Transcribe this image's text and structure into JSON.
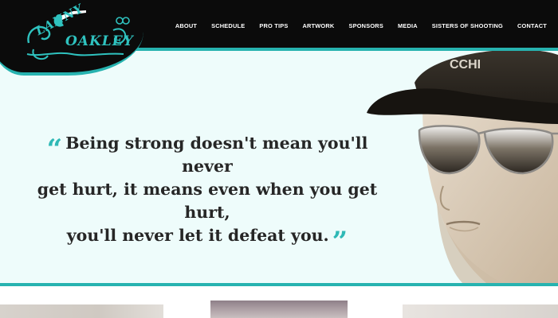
{
  "brand": {
    "logo_line1": "LANNY",
    "logo_line2": "OAKLEY"
  },
  "nav": {
    "items": [
      {
        "label": "ABOUT"
      },
      {
        "label": "SCHEDULE"
      },
      {
        "label": "PRO TIPS"
      },
      {
        "label": "ARTWORK"
      },
      {
        "label": "SPONSORS"
      },
      {
        "label": "MEDIA"
      },
      {
        "label": "SISTERS OF SHOOTING"
      },
      {
        "label": "CONTACT"
      }
    ]
  },
  "hero": {
    "quote_open_mark": "“",
    "quote_close_mark": "”",
    "quote_line1": "Being strong doesn't mean you'll never",
    "quote_line2": "get hurt, it means even when you get hurt,",
    "quote_line3": "you'll never let it defeat you.",
    "cap_text": "CCHI"
  },
  "colors": {
    "header_bg": "#0b0b0b",
    "accent_teal": "#27b3b0",
    "hero_bg": "#eefcfb",
    "quote_text": "#262626"
  },
  "icons": {
    "logo": "lanny-oakley-logo-icon",
    "portrait": "woman-in-cap-and-sunglasses-image",
    "quote_open": "quote-open-icon",
    "quote_close": "quote-close-icon"
  }
}
